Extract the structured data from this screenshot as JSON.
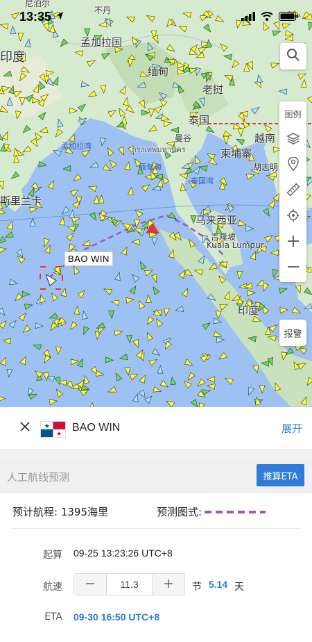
{
  "status": {
    "time": "13:35"
  },
  "map": {
    "labels": {
      "nepal": "尼泊尔",
      "bhutan": "不丹",
      "india": "印度",
      "bangladesh": "孟加拉国",
      "myanmar": "缅甸",
      "laos": "老挝",
      "thailand": "泰国",
      "bangkok": "曼谷",
      "bangkok_thai": "กรุงเทพมหานคร",
      "vietnam": "越南",
      "cambodia": "柬埔寨",
      "bay_of_bengal": "孟加拉湾",
      "andaman_sea": "缅甸海",
      "gulf_thailand": "泰国湾",
      "sri_lanka": "斯里兰卡",
      "malaysia": "马来西亚",
      "kuala_lumpur": "吉隆坡",
      "kuala_lumpur_en": "Kuala Lumpur",
      "hcm": "胡志明",
      "indonesia": "印度"
    },
    "ship_label": "BAO WIN",
    "legend_label": "图例",
    "alarm_label": "报警"
  },
  "panel": {
    "ship_name": "BAO WIN",
    "expand": "展开",
    "section_title": "人工航线预测",
    "eta_button": "推算ETA",
    "distance": "预计航程: 1395海里",
    "forecast_style": "预测图式:",
    "start_label": "起算",
    "start_value": "09-25 13:23:26 UTC+8",
    "speed_label": "航速",
    "speed_value": "11.3",
    "speed_unit": "节",
    "days_value": "5.14",
    "days_unit": "天",
    "eta_label": "ETA",
    "eta_value": "09-30 16:50 UTC+8"
  },
  "colors": {
    "accent": "#2f7cd9",
    "route": "#9b59b6",
    "ship": "#ffff33",
    "sea": "#9ec1f4",
    "land": "#d3e9c7"
  }
}
